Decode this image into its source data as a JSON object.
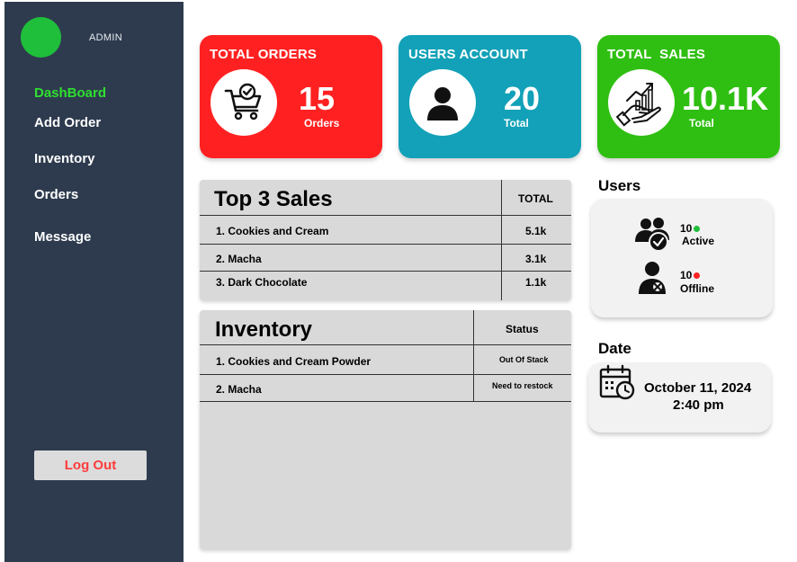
{
  "sidebar": {
    "admin_label": "ADMIN",
    "nav": [
      "DashBoard",
      "Add Order",
      "Inventory",
      "Orders",
      "Message"
    ],
    "active_index": 0,
    "logout_label": "Log Out"
  },
  "cards": {
    "orders": {
      "title": "TOTAL ORDERS",
      "value": "15",
      "sub": "Orders",
      "color": "#ff2121",
      "icon": "cart-check-icon"
    },
    "users": {
      "title": "USERS ACCOUNT",
      "value": "20",
      "sub": "Total",
      "color": "#12a1b8",
      "icon": "user-icon"
    },
    "sales": {
      "title": "TOTAL  SALES",
      "value": "10.1K",
      "sub": "Total",
      "color": "#2fbf12",
      "icon": "sales-growth-icon"
    }
  },
  "top_sales": {
    "title": "Top 3 Sales",
    "col_total": "TOTAL",
    "rows": [
      {
        "name": "1. Cookies and Cream",
        "total": "5.1k"
      },
      {
        "name": "2. Macha",
        "total": "3.1k"
      },
      {
        "name": "3. Dark Chocolate",
        "total": "1.1k"
      }
    ]
  },
  "inventory": {
    "title": "Inventory",
    "col_status": "Status",
    "rows": [
      {
        "name": "1. Cookies and Cream Powder",
        "status": "Out Of Stack"
      },
      {
        "name": "2. Macha",
        "status": "Need to restock"
      }
    ]
  },
  "users_panel": {
    "title": "Users",
    "active_count": "10",
    "active_label": "Active",
    "offline_count": "10",
    "offline_label": "Offline",
    "active_color": "#1fbf3c",
    "offline_color": "#ff2121"
  },
  "date_panel": {
    "title": "Date",
    "date": "October 11, 2024",
    "time": "2:40 pm"
  }
}
